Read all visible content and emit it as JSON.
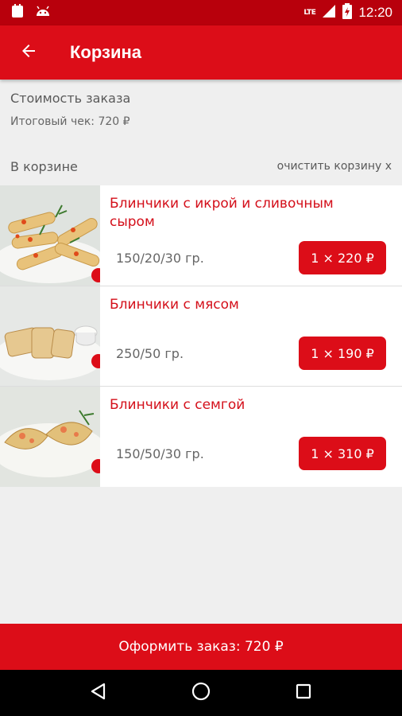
{
  "status_bar": {
    "time": "12:20",
    "network": "LTE",
    "icons": [
      "notification-icon",
      "android-icon",
      "signal-icon",
      "battery-icon"
    ]
  },
  "app_bar": {
    "title": "Корзина",
    "back_icon": "arrow-left-icon"
  },
  "summary": {
    "title": "Стоимость заказа",
    "total": "Итоговый чек: 720 ₽"
  },
  "cart": {
    "label": "В корзине",
    "clear_label": "очистить корзину x",
    "items": [
      {
        "name": "Блинчики с икрой и сливочным сыром",
        "weight": "150/20/30 гр.",
        "quantity_price": "1 × 220 ₽"
      },
      {
        "name": "Блинчики с мясом",
        "weight": "250/50 гр.",
        "quantity_price": "1 × 190 ₽"
      },
      {
        "name": "Блинчики с семгой",
        "weight": "150/50/30 гр.",
        "quantity_price": "1 × 310 ₽"
      }
    ]
  },
  "checkout": {
    "label": "Оформить заказ: 720 ₽"
  },
  "nav_bar": {
    "icons": [
      "back-triangle-icon",
      "home-circle-icon",
      "recents-square-icon"
    ]
  },
  "colors": {
    "primary": "#dc0d18",
    "status_bar": "#b8000c",
    "item_name": "#d40f1a",
    "background": "#efefef"
  }
}
